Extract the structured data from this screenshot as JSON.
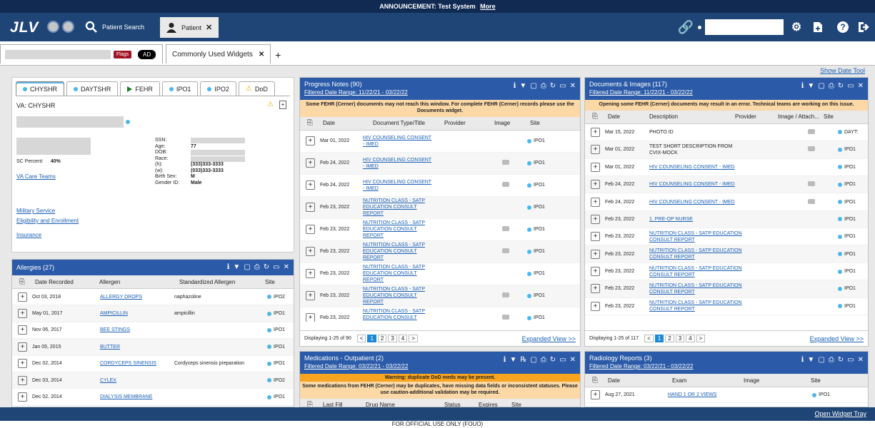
{
  "announcement": {
    "label": "ANNOUNCEMENT: Test System",
    "more": "More"
  },
  "nav": {
    "logo": "JLV",
    "patient_search": "Patient Search",
    "patient_tab": "Patient"
  },
  "subtabs": {
    "flags": "Flags",
    "ad": "AD",
    "widgets_tab": "Commonly Used Widgets"
  },
  "show_date_tool": "Show Date Tool",
  "patient": {
    "sites": [
      {
        "label": "CHYSHR",
        "marker": "dot"
      },
      {
        "label": "DAYTSHR",
        "marker": "dot"
      },
      {
        "label": "FEHR",
        "marker": "triangle"
      },
      {
        "label": "IPO1",
        "marker": "dot"
      },
      {
        "label": "IPO2",
        "marker": "dot"
      },
      {
        "label": "DoD",
        "marker": "warning"
      }
    ],
    "va_site": "VA: CHYSHR",
    "demographics": [
      {
        "label": "SSN:",
        "value": ""
      },
      {
        "label": "Age:",
        "value": "77"
      },
      {
        "label": "DOB:",
        "value": ""
      },
      {
        "label": "Race:",
        "value": ""
      },
      {
        "label": "(h):",
        "value": "(333)333-3333"
      },
      {
        "label": "(w):",
        "value": "(033)333-3333"
      },
      {
        "label": "Birth Sex:",
        "value": "M"
      },
      {
        "label": "Gender ID:",
        "value": "Male"
      }
    ],
    "sc_percent_label": "SC Percent:",
    "sc_percent_value": "40%",
    "links": [
      "VA Care Teams",
      "Military Service",
      "Eligibility and Enrollment",
      "Insurance"
    ]
  },
  "allergies": {
    "title": "Allergies (27)",
    "columns": [
      "Date Recorded",
      "Allergen",
      "Standardized Allergen",
      "Site"
    ],
    "rows": [
      {
        "date": "Oct 03, 2018",
        "allergen": "ALLERGY DROPS",
        "std": "naphazoline",
        "site": "IPO2"
      },
      {
        "date": "May 01, 2017",
        "allergen": "AMPICILLIN",
        "std": "ampicillin",
        "site": "IPO1"
      },
      {
        "date": "Nov 06, 2017",
        "allergen": "BEE STINGS",
        "std": "",
        "site": "IPO1"
      },
      {
        "date": "Jan 05, 2015",
        "allergen": "BUTTER",
        "std": "",
        "site": "IPO1"
      },
      {
        "date": "Dec 02, 2014",
        "allergen": "CORDYCEPS SINENSIS",
        "std": "Cordyceps sinensis preparation",
        "site": "IPO1"
      },
      {
        "date": "Dec 03, 2014",
        "allergen": "CYLEX",
        "std": "",
        "site": "IPO2"
      },
      {
        "date": "Dec 02, 2014",
        "allergen": "DIALYSIS MEMBRANE",
        "std": "",
        "site": "IPO1"
      }
    ]
  },
  "progress_notes": {
    "title": "Progress Notes (90)",
    "filter": "Filtered Date Range: 11/22/21 - 03/22/22",
    "notice": "Some FEHR (Cerner) documents may not reach this window. For complete FEHR (Cerner) records please use the Documents widget.",
    "columns": [
      "Date",
      "Document Type/Title",
      "Provider",
      "Image",
      "Site"
    ],
    "rows": [
      {
        "date": "Mar 01, 2022",
        "title": "HIV COUNSELING CONSENT - IMED",
        "image": false,
        "site": "IPO1"
      },
      {
        "date": "Feb 24, 2022",
        "title": "HIV COUNSELING CONSENT - IMED",
        "image": true,
        "site": "IPO1"
      },
      {
        "date": "Feb 24, 2022",
        "title": "HIV COUNSELING CONSENT - IMED",
        "image": true,
        "site": "IPO1"
      },
      {
        "date": "Feb 23, 2022",
        "title": "NUTRITION CLASS - SATP EDUCATION CONSULT REPORT",
        "image": false,
        "site": "IPO1"
      },
      {
        "date": "Feb 23, 2022",
        "title": "NUTRITION CLASS - SATP EDUCATION CONSULT REPORT",
        "image": true,
        "site": "IPO1"
      },
      {
        "date": "Feb 23, 2022",
        "title": "NUTRITION CLASS - SATP EDUCATION CONSULT REPORT",
        "image": true,
        "site": "IPO1"
      },
      {
        "date": "Feb 23, 2022",
        "title": "NUTRITION CLASS - SATP EDUCATION CONSULT REPORT",
        "image": false,
        "site": "IPO1"
      },
      {
        "date": "Feb 23, 2022",
        "title": "NUTRITION CLASS - SATP EDUCATION CONSULT REPORT",
        "image": true,
        "site": "IPO1"
      },
      {
        "date": "Feb 23, 2022",
        "title": "NUTRITION CLASS - SATP EDUCATION CONSULT REPORT",
        "image": true,
        "site": "IPO1"
      }
    ],
    "displaying": "Displaying 1-25 of 90",
    "pages": [
      "1",
      "2",
      "3",
      "4"
    ],
    "expanded": "Expanded View >>"
  },
  "documents": {
    "title": "Documents & Images (117)",
    "filter": "Filtered Date Range: 11/22/21 - 03/22/22",
    "notice": "Opening some FEHR (Cerner) documents may result in an error. Technical teams are working on this issue.",
    "columns": [
      "Date",
      "Description",
      "Provider",
      "Image / Attach...",
      "Site"
    ],
    "rows": [
      {
        "date": "Mar 15, 2022",
        "desc": "PHOTO ID",
        "link": false,
        "image": true,
        "site": "DAYT:"
      },
      {
        "date": "Mar 01, 2022",
        "desc": "TEST SHORT DESCRIPTION FROM CVIX-MOCK",
        "link": false,
        "image": true,
        "site": "IPO1"
      },
      {
        "date": "Mar 01, 2022",
        "desc": "HIV COUNSELING CONSENT - IMED",
        "link": true,
        "image": false,
        "site": "IPO1"
      },
      {
        "date": "Feb 24, 2022",
        "desc": "HIV COUNSELING CONSENT - IMED",
        "link": true,
        "image": true,
        "site": "IPO1"
      },
      {
        "date": "Feb 24, 2022",
        "desc": "HIV COUNSELING CONSENT - IMED",
        "link": true,
        "image": true,
        "site": "IPO1"
      },
      {
        "date": "Feb 23, 2022",
        "desc": "1. PRE-OP NURSE",
        "link": true,
        "image": false,
        "site": "IPO1"
      },
      {
        "date": "Feb 23, 2022",
        "desc": "NUTRITION CLASS - SATP EDUCATION CONSULT REPORT",
        "link": true,
        "image": false,
        "site": "IPO1"
      },
      {
        "date": "Feb 23, 2022",
        "desc": "NUTRITION CLASS - SATP EDUCATION CONSULT REPORT",
        "link": true,
        "image": false,
        "site": "IPO1"
      },
      {
        "date": "Feb 23, 2022",
        "desc": "NUTRITION CLASS - SATP EDUCATION CONSULT REPORT",
        "link": true,
        "image": false,
        "site": "IPO1"
      },
      {
        "date": "Feb 23, 2022",
        "desc": "NUTRITION CLASS - SATP EDUCATION CONSULT REPORT",
        "link": true,
        "image": false,
        "site": "IPO1"
      },
      {
        "date": "Feb 23, 2022",
        "desc": "NUTRITION CLASS - SATP EDUCATION CONSULT REPORT",
        "link": true,
        "image": false,
        "site": "IPO1"
      }
    ],
    "displaying": "Displaying 1-25 of 117",
    "pages": [
      "1",
      "2",
      "3",
      "4"
    ],
    "expanded": "Expanded View >>"
  },
  "medications": {
    "title": "Medications - Outpatient (2)",
    "filter": "Filtered Date Range: 03/22/21 - 03/22/22",
    "warning": "Warning: duplicate DoD meds may be present.",
    "notice": "Some medications from FEHR (Cerner) may be duplicates, have missing data fields or inconsistent statuses. Please use caution-additional validation may be required.",
    "columns": [
      "Last Fill",
      "Drug Name",
      "Status",
      "Expires",
      "Site"
    ]
  },
  "radiology": {
    "title": "Radiology Reports (3)",
    "filter": "Filtered Date Range: 03/22/21 - 03/22/22",
    "columns": [
      "Date",
      "Exam",
      "Image",
      "Site"
    ],
    "rows": [
      {
        "date": "Aug 27, 2021",
        "exam": "HAND 1 OR 2 VIEWS",
        "site": "IPO1"
      }
    ]
  },
  "footer": {
    "open_tray": "Open Widget Tray",
    "fouo": "FOR OFFICIAL USE ONLY (FOUO)"
  },
  "colors": {
    "nav": "#1e4576",
    "panel_header": "#2a5aa8",
    "site_dot": "#4ab8ea",
    "notice": "#fbd8a6",
    "warning": "#f7a520",
    "flags": "#a01525"
  }
}
